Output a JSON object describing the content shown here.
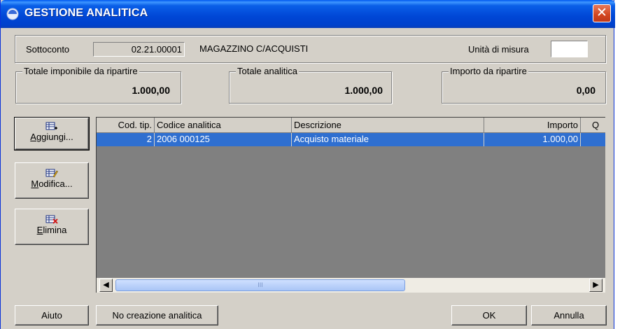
{
  "window": {
    "title": "GESTIONE ANALITICA",
    "close_label": "✕"
  },
  "header": {
    "sottoconto_label": "Sottoconto",
    "sottoconto_code": "02.21.00001",
    "sottoconto_desc": "MAGAZZINO C/ACQUISTI",
    "unita_label": "Unità di misura",
    "unita_value": ""
  },
  "totals": {
    "imponibile_label": "Totale imponibile da ripartire",
    "imponibile_value": "1.000,00",
    "analitica_label": "Totale analitica",
    "analitica_value": "1.000,00",
    "ripartire_label": "Importo da ripartire",
    "ripartire_value": "0,00"
  },
  "actions": {
    "aggiungi": {
      "pre": "",
      "key": "A",
      "post": "ggiungi..."
    },
    "modifica": {
      "pre": "",
      "key": "M",
      "post": "odifica..."
    },
    "elimina": {
      "pre": "",
      "key": "E",
      "post": "limina"
    }
  },
  "grid": {
    "columns": [
      "Cod. tip.",
      "Codice analitica",
      "Descrizione",
      "Importo",
      "Q"
    ],
    "rows": [
      {
        "cod_tip": "2",
        "codice": "2006 000125",
        "descrizione": "Acquisto materiale",
        "importo": "1.000,00",
        "q": ""
      }
    ],
    "scroll_thumb": "III"
  },
  "footer": {
    "aiuto": "Aiuto",
    "no_creazione": "No creazione analitica",
    "ok": "OK",
    "annulla": "Annulla"
  },
  "colors": {
    "title_bar": "#0046d5",
    "selection": "#2f6fd0",
    "grid_bg": "#808080",
    "window_bg": "#d4d0c8"
  },
  "icons": [
    "app-icon",
    "close-icon",
    "add-row-icon",
    "edit-row-icon",
    "delete-row-icon",
    "scroll-left-icon",
    "scroll-right-icon"
  ]
}
